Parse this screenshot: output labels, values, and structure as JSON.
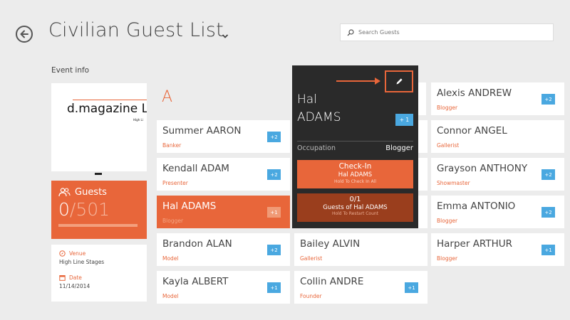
{
  "header": {
    "title": "Civilian Guest List",
    "search_placeholder": "Search Guests"
  },
  "event": {
    "section_label": "Event info",
    "logo_text": "d.magazine L",
    "logo_sub": "High Li",
    "guests_label": "Guests",
    "checked_in": "0",
    "separator": "/",
    "total": "501",
    "progress_fraction": 0,
    "venue_label": "Venue",
    "venue_value": "High Line Stages",
    "date_label": "Date",
    "date_value": "11/14/2014"
  },
  "section_letter": "A",
  "guests": [
    {
      "name": "Summer AARON",
      "role": "Banker",
      "plus": "+2"
    },
    {
      "name": "Kendall ADAM",
      "role": "Presenter",
      "plus": "+2"
    },
    {
      "name": "Hal ADAMS",
      "role": "Blogger",
      "plus": "+1"
    },
    {
      "name": "Brandon ALAN",
      "role": "Model",
      "plus": "+2"
    },
    {
      "name": "Kayla ALBERT",
      "role": "Model",
      "plus": "+1"
    },
    {
      "name": "Bailey ALVIN",
      "role": "Gallerist",
      "plus": ""
    },
    {
      "name": "Collin ANDRE",
      "role": "Founder",
      "plus": "+1"
    },
    {
      "name": "Alexis ANDREW",
      "role": "Blogger",
      "plus": "+2"
    },
    {
      "name": "Connor ANGEL",
      "role": "Gallerist",
      "plus": ""
    },
    {
      "name": "Grayson ANTHONY",
      "role": "Showmaster",
      "plus": "+2"
    },
    {
      "name": "Emma ANTONIO",
      "role": "Blogger",
      "plus": "+2"
    },
    {
      "name": "Harper ARTHUR",
      "role": "Blogger",
      "plus": "+1"
    }
  ],
  "popup": {
    "first_name": "Hal",
    "last_name": "ADAMS",
    "plus": "+ 1",
    "occupation_label": "Occupation",
    "occupation_value": "Blogger",
    "checkin_title": "Check-In",
    "checkin_name": "Hal ADAMS",
    "checkin_hint": "Hold To Check In All",
    "restart_count": "0/1",
    "restart_sub": "Guests of Hal ADAMS",
    "restart_hint": "Hold To Restart Count"
  },
  "colors": {
    "accent": "#e8663a",
    "badge": "#4aa8e0",
    "popup_bg": "#2a2a2a"
  }
}
